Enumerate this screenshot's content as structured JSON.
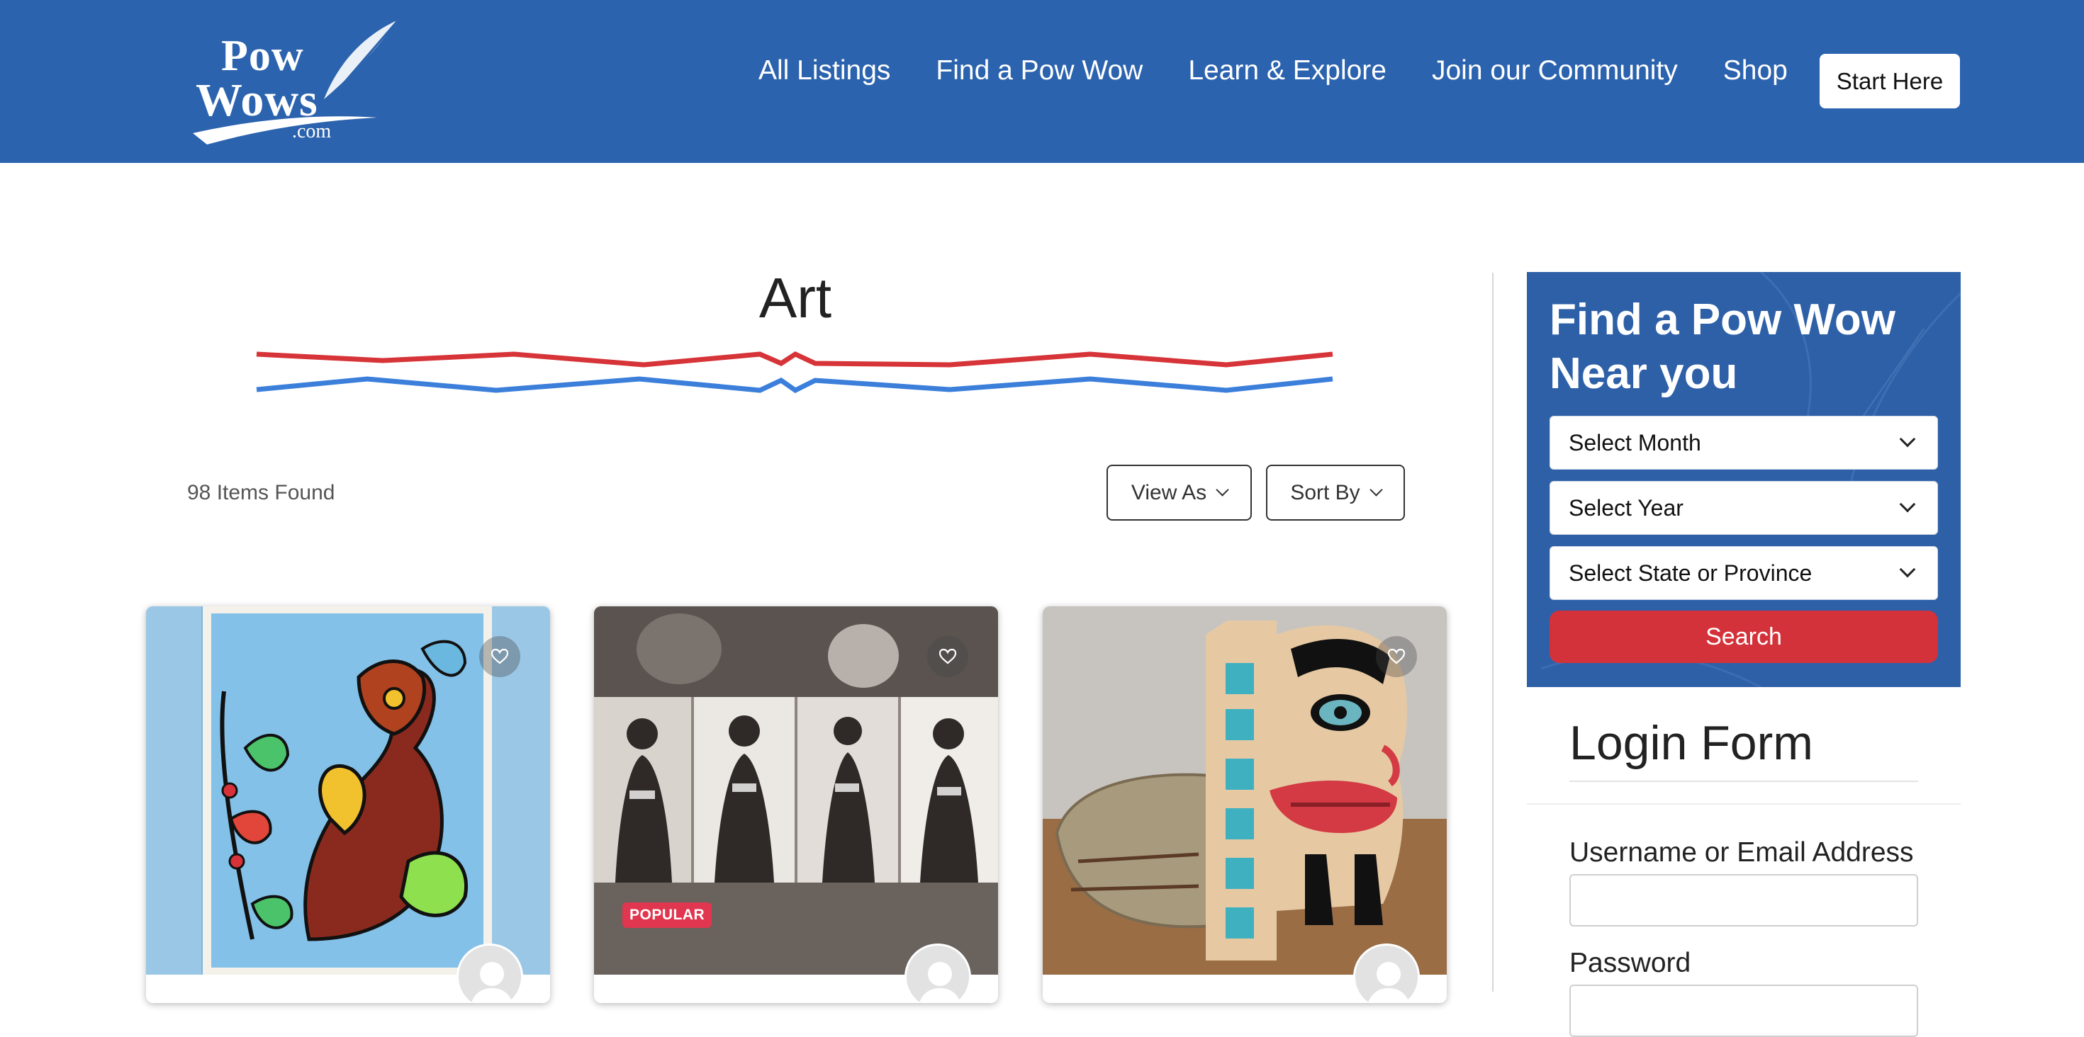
{
  "header": {
    "logo": {
      "line1": "Pow",
      "line2": "Wows",
      "line3": ".com"
    },
    "nav": [
      "All Listings",
      "Find a Pow Wow",
      "Learn & Explore",
      "Join our Community",
      "Shop"
    ],
    "cta": "Start Here",
    "bg_color": "#2c63ae"
  },
  "main": {
    "title": "Art",
    "items_found": "98 Items Found",
    "view_as": "View As",
    "sort_by": "Sort By",
    "cards": [
      {
        "image": "ojibwe-woodland-style-painting",
        "badge": ""
      },
      {
        "image": "portrait-photo-collage",
        "badge": "POPULAR"
      },
      {
        "image": "carved-wooden-totem-and-basket",
        "badge": ""
      }
    ]
  },
  "finder": {
    "title": "Find a Pow Wow Near you",
    "month_placeholder": "Select Month",
    "year_placeholder": "Select Year",
    "state_placeholder": "Select State or Province",
    "search": "Search",
    "accent_color": "#d4323a"
  },
  "login": {
    "title": "Login Form",
    "username_label": "Username or Email Address",
    "password_label": "Password"
  }
}
